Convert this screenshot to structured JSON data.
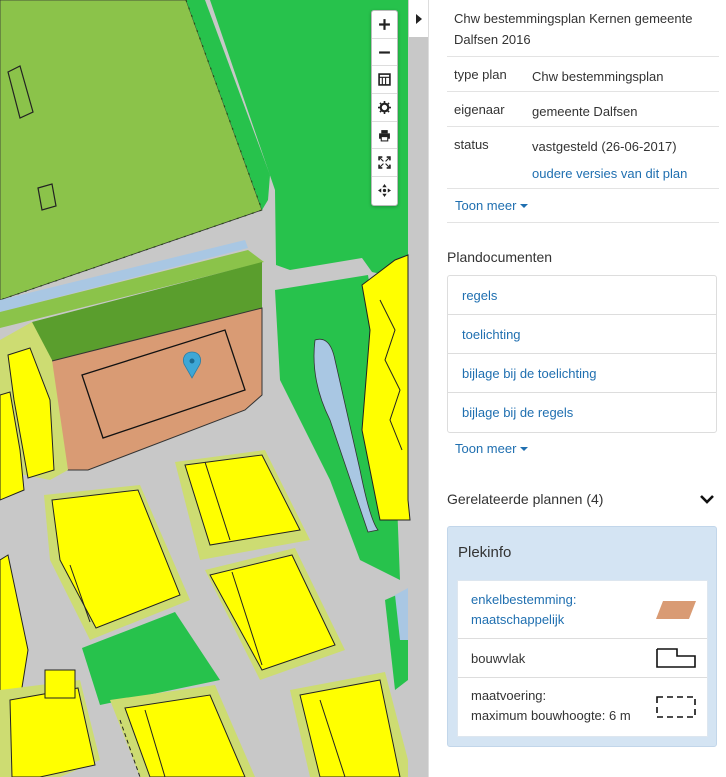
{
  "map": {
    "controls": [
      {
        "name": "zoom-in",
        "icon": "plus-icon"
      },
      {
        "name": "zoom-out",
        "icon": "minus-icon"
      },
      {
        "name": "layers",
        "icon": "layers-icon"
      },
      {
        "name": "settings",
        "icon": "gear-icon"
      },
      {
        "name": "print",
        "icon": "print-icon"
      },
      {
        "name": "fullscreen",
        "icon": "expand-icon"
      },
      {
        "name": "locate",
        "icon": "crosshair-icon"
      }
    ],
    "colors": {
      "green_light": "#8bc34a",
      "green_bright": "#27c24c",
      "green_dark": "#5a9e2d",
      "yellow": "#ffff00",
      "olive": "#cddc72",
      "salmon": "#d99b74",
      "road": "#c8c8c8",
      "water": "#a9c7e3",
      "marker": "#3ea7d6"
    }
  },
  "panel": {
    "plan_title": "Chw bestemmingsplan Kernen gemeente Dalfsen 2016",
    "info": [
      {
        "key": "type plan",
        "value": "Chw bestemmingsplan"
      },
      {
        "key": "eigenaar",
        "value": "gemeente Dalfsen"
      },
      {
        "key": "status",
        "value": "vastgesteld (26-06-2017)",
        "link": "oudere versies van dit plan"
      }
    ],
    "toon_meer_1": "Toon meer",
    "plandocumenten_title": "Plandocumenten",
    "documents": [
      "regels",
      "toelichting",
      "bijlage bij de toelichting",
      "bijlage bij de regels"
    ],
    "toon_meer_2": "Toon meer",
    "related_title": "Gerelateerde plannen (4)",
    "plekinfo": {
      "title": "Plekinfo",
      "items": [
        {
          "line1": "enkelbestemming:",
          "line2": "maatschappelijk",
          "symbol": "salmon-parallelogram",
          "is_link": true
        },
        {
          "line1": "bouwvlak",
          "line2": "",
          "symbol": "bouwvlak-outline",
          "is_link": false
        },
        {
          "line1": "maatvoering:",
          "line2": "maximum bouwhoogte: 6 m",
          "symbol": "dashed-box",
          "is_link": false
        }
      ]
    }
  }
}
